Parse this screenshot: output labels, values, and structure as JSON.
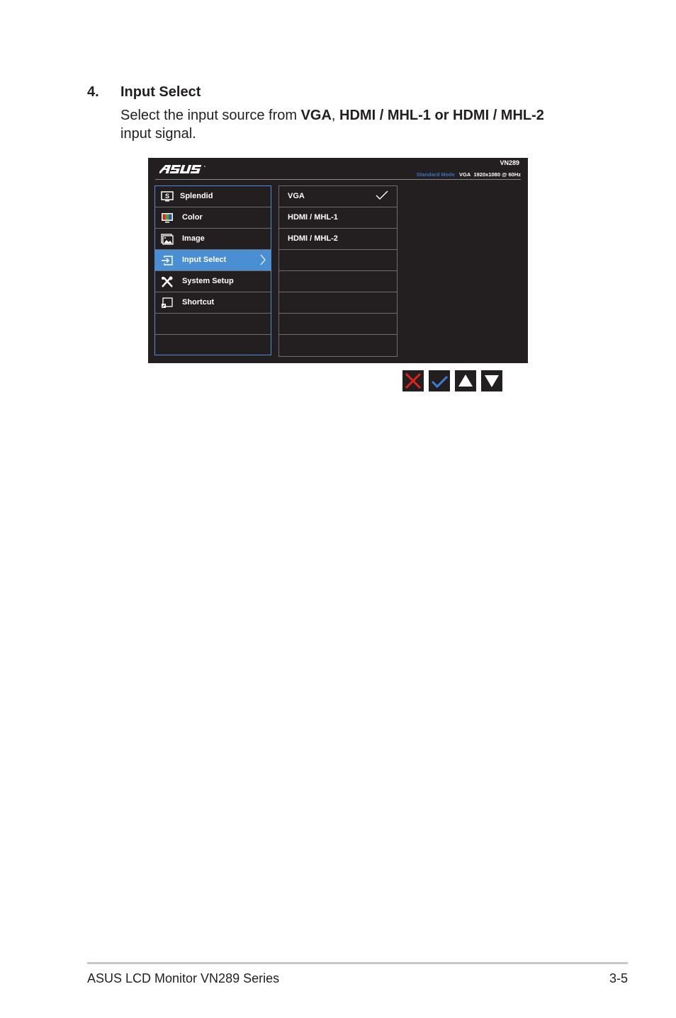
{
  "step": {
    "number": "4.",
    "title": "Input Select",
    "desc_prefix": "Select the input source from ",
    "opt1": "VGA",
    "sep": ", ",
    "opt2": "HDMI / MHL-1 or HDMI / MHL-2",
    "desc_suffix": "input signal."
  },
  "osd": {
    "logo": "ASUS",
    "model": "VN289",
    "mode": "Standard Mode",
    "input": "VGA",
    "resolution": "1920x1080 @ 60Hz",
    "accent_color": "#4a8fd4",
    "menu": [
      {
        "label": "Splendid",
        "icon": "splendid-icon"
      },
      {
        "label": "Color",
        "icon": "color-icon"
      },
      {
        "label": "Image",
        "icon": "image-icon"
      },
      {
        "label": "Input Select",
        "icon": "input-select-icon",
        "active": true
      },
      {
        "label": "System Setup",
        "icon": "system-setup-icon"
      },
      {
        "label": "Shortcut",
        "icon": "shortcut-icon"
      },
      {
        "label": ""
      },
      {
        "label": ""
      }
    ],
    "submenu": [
      {
        "label": "VGA",
        "checked": true
      },
      {
        "label": "HDMI / MHL-1"
      },
      {
        "label": "HDMI / MHL-2"
      },
      {
        "label": ""
      },
      {
        "label": ""
      },
      {
        "label": ""
      },
      {
        "label": ""
      },
      {
        "label": ""
      }
    ]
  },
  "keys": [
    {
      "name": "close",
      "color": "#e2231a"
    },
    {
      "name": "confirm",
      "color": "#3b7fd0"
    },
    {
      "name": "up",
      "color": "#ffffff"
    },
    {
      "name": "down",
      "color": "#ffffff"
    }
  ],
  "footer": {
    "left": "ASUS LCD Monitor VN289 Series",
    "right": "3-5"
  }
}
